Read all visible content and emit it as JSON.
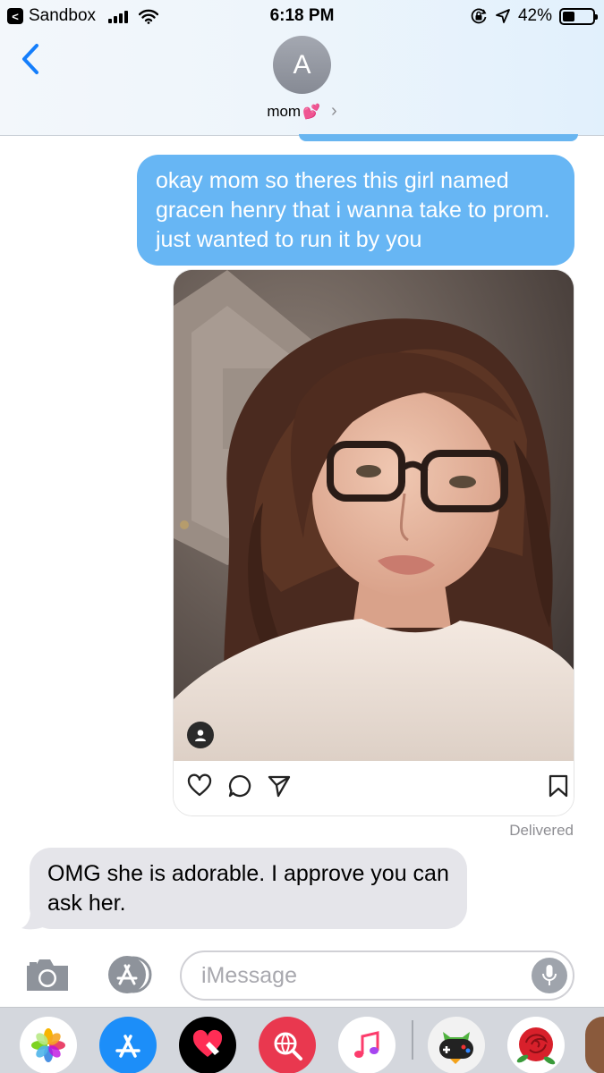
{
  "status_bar": {
    "back_app": "Sandbox",
    "time": "6:18 PM",
    "battery": "42%",
    "battery_level": 0.42
  },
  "header": {
    "avatar_initial": "A",
    "contact_name": "mom",
    "contact_emoji": "💕",
    "chevron": "›"
  },
  "messages": {
    "sent_text": "okay mom so theres this girl named gracen henry that i wanna take to prom. just wanted to run it by you",
    "delivered": "Delivered",
    "received_text": "OMG she is adorable. I approve you can ask her."
  },
  "input": {
    "placeholder": "iMessage"
  },
  "icons": {
    "back": "chevron-left-icon",
    "signal": "signal-bars-icon",
    "wifi": "wifi-icon",
    "orientation_lock": "orientation-lock-icon",
    "location": "location-arrow-icon",
    "battery": "battery-icon",
    "camera": "camera-icon",
    "apps": "app-store-icon",
    "mic": "microphone-icon"
  },
  "drawer_apps": [
    "Photos",
    "App Store",
    "Digital Touch",
    "Images Search",
    "Music",
    "Game",
    "Rose Stickers"
  ],
  "colors": {
    "sent_bubble": "#67b6f4",
    "received_bubble": "#e5e5ea",
    "accent": "#147efb"
  }
}
